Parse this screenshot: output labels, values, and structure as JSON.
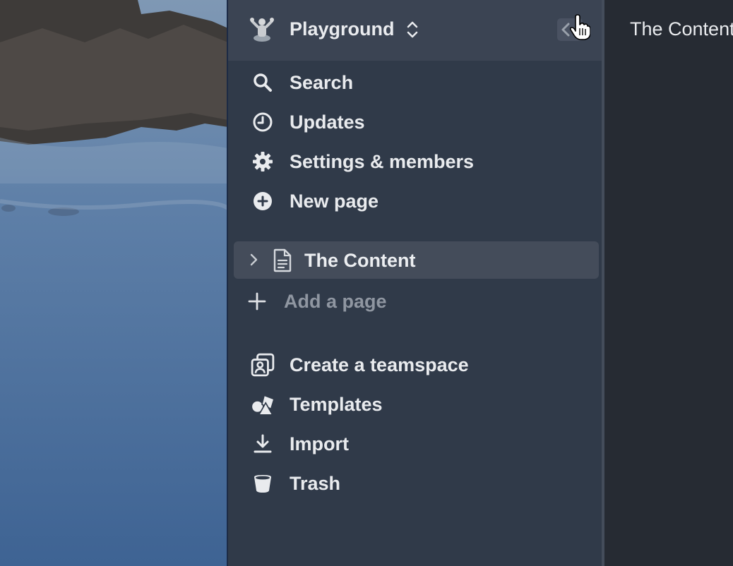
{
  "workspace": {
    "name": "Playground"
  },
  "nav": {
    "search": "Search",
    "updates": "Updates",
    "settings": "Settings & members",
    "new_page": "New page"
  },
  "pages": {
    "items": [
      {
        "label": "The Content"
      }
    ],
    "add_label": "Add a page"
  },
  "footer_nav": {
    "teamspace": "Create a teamspace",
    "templates": "Templates",
    "import": "Import",
    "trash": "Trash"
  },
  "main": {
    "title": "The Content"
  },
  "colors": {
    "sidebar_bg": "#303a49",
    "header_bg": "#3b4453",
    "selected_row_bg": "#444c5a",
    "main_bg": "#262b33",
    "text": "#e9ebee",
    "muted_text": "#8f96a1"
  },
  "icons": [
    "workspace-avatar-icon",
    "chevron-updown-icon",
    "collapse-sidebar-icon",
    "hand-cursor-icon",
    "search-icon",
    "clock-icon",
    "gear-icon",
    "plus-circle-icon",
    "chevron-right-icon",
    "document-icon",
    "plus-icon",
    "teamspace-icon",
    "templates-icon",
    "import-icon",
    "trash-icon"
  ]
}
